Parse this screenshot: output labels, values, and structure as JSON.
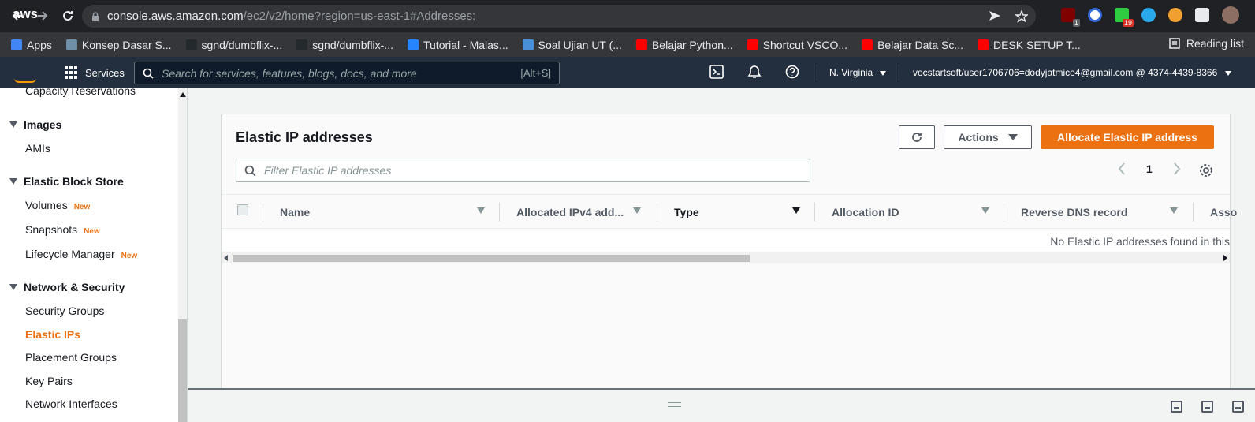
{
  "browser": {
    "url_host": "console.aws.amazon.com",
    "url_path": "/ec2/v2/home?region=us-east-1#Addresses:",
    "bookmarks": [
      {
        "label": "Apps",
        "color": "#4285f4"
      },
      {
        "label": "Konsep Dasar S...",
        "color": "#6f8fa8"
      },
      {
        "label": "sgnd/dumbflix-...",
        "color": "#24292e"
      },
      {
        "label": "sgnd/dumbflix-...",
        "color": "#24292e"
      },
      {
        "label": "Tutorial - Malas...",
        "color": "#2684ff"
      },
      {
        "label": "Soal Ujian UT (...",
        "color": "#4a90d9"
      },
      {
        "label": "Belajar Python...",
        "color": "#ff0000"
      },
      {
        "label": "Shortcut VSCO...",
        "color": "#ff0000"
      },
      {
        "label": "Belajar Data Sc...",
        "color": "#ff0000"
      },
      {
        "label": "DESK SETUP T...",
        "color": "#ff0000"
      }
    ],
    "reading_list": "Reading list",
    "ext_badges": {
      "ublock": "1",
      "chat": "19"
    }
  },
  "aws_header": {
    "logo": "aws",
    "services": "Services",
    "search_placeholder": "Search for services, features, blogs, docs, and more",
    "search_shortcut": "[Alt+S]",
    "region": "N. Virginia",
    "account": "vocstartsoft/user1706706=dodyjatmico4@gmail.com @ 4374-4439-8366"
  },
  "sidebar": {
    "capacity": "Capacity Reservations",
    "images_head": "Images",
    "amis": "AMIs",
    "ebs_head": "Elastic Block Store",
    "volumes": "Volumes",
    "snapshots": "Snapshots",
    "lifecycle": "Lifecycle Manager",
    "new_badge": "New",
    "netsec_head": "Network & Security",
    "security_groups": "Security Groups",
    "elastic_ips": "Elastic IPs",
    "placement_groups": "Placement Groups",
    "key_pairs": "Key Pairs",
    "network_interfaces": "Network Interfaces"
  },
  "main": {
    "title": "Elastic IP addresses",
    "actions_label": "Actions",
    "allocate_label": "Allocate Elastic IP address",
    "filter_placeholder": "Filter Elastic IP addresses",
    "page_number": "1",
    "columns": [
      "Name",
      "Allocated IPv4 add...",
      "Type",
      "Allocation ID",
      "Reverse DNS record",
      "Asso"
    ],
    "empty_message": "No Elastic IP addresses found in this"
  },
  "colors": {
    "accent": "#ec7211",
    "aws_nav": "#232f3e",
    "chrome_dark": "#202124"
  }
}
